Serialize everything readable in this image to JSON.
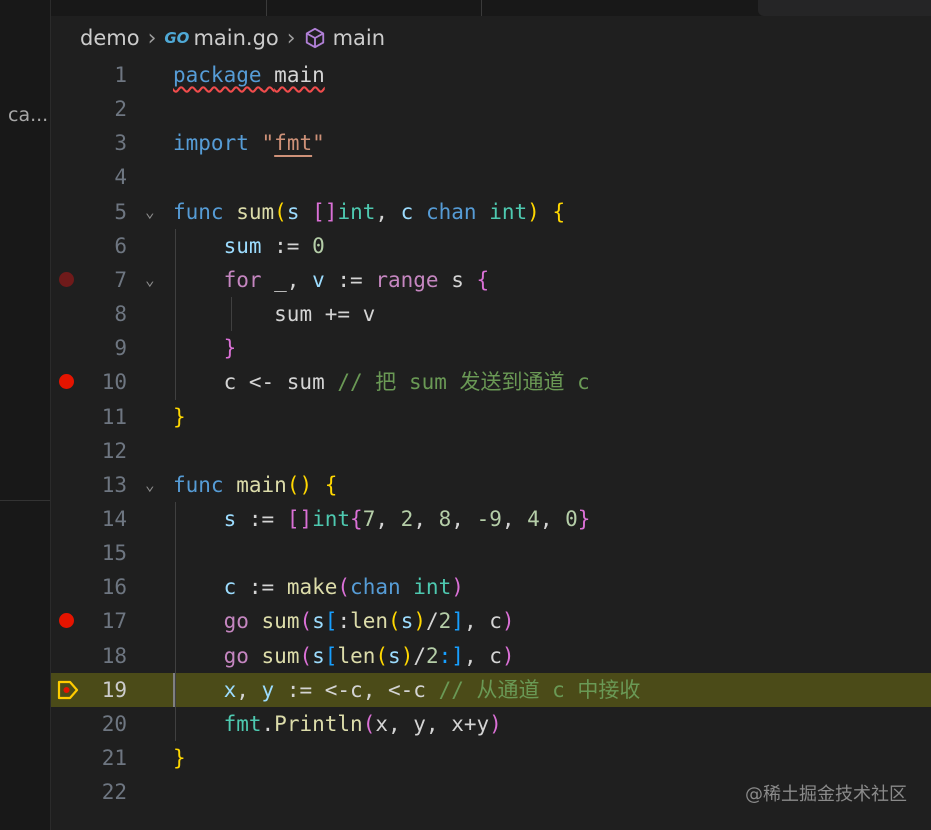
{
  "sidebar": {
    "label": "ca..."
  },
  "breadcrumb": {
    "folder": "demo",
    "file_icon_text": "GO",
    "file": "main.go",
    "symbol": "main"
  },
  "lines": [
    {
      "n": "1",
      "tokens": [
        [
          "package",
          "kw squig"
        ],
        [
          " ",
          "squig"
        ],
        [
          "main",
          "squig"
        ]
      ]
    },
    {
      "n": "2",
      "tokens": []
    },
    {
      "n": "3",
      "tokens": [
        [
          "import",
          "kw"
        ],
        [
          " ",
          ""
        ],
        [
          "\"",
          "str"
        ],
        [
          "fmt",
          "str str-u"
        ],
        [
          "\"",
          "str"
        ]
      ]
    },
    {
      "n": "4",
      "tokens": []
    },
    {
      "n": "5",
      "fold": true,
      "tokens": [
        [
          "func",
          "kw"
        ],
        [
          " ",
          ""
        ],
        [
          "sum",
          "fn"
        ],
        [
          "(",
          "b1"
        ],
        [
          "s",
          "var"
        ],
        [
          " ",
          ""
        ],
        [
          "[]",
          "b2"
        ],
        [
          "int",
          "type"
        ],
        [
          ", ",
          ""
        ],
        [
          "c",
          "var"
        ],
        [
          " ",
          ""
        ],
        [
          "chan",
          "kw"
        ],
        [
          " ",
          ""
        ],
        [
          "int",
          "type"
        ],
        [
          ")",
          "b1"
        ],
        [
          " ",
          ""
        ],
        [
          "{",
          "b1"
        ]
      ]
    },
    {
      "n": "6",
      "tokens": [
        [
          "    ",
          ""
        ],
        [
          "sum",
          "var"
        ],
        [
          " := ",
          ""
        ],
        [
          "0",
          "num"
        ]
      ]
    },
    {
      "n": "7",
      "bp": "dim",
      "fold": true,
      "tokens": [
        [
          "    ",
          ""
        ],
        [
          "for",
          "ctl"
        ],
        [
          " _, ",
          ""
        ],
        [
          "v",
          "var"
        ],
        [
          " := ",
          ""
        ],
        [
          "range",
          "ctl"
        ],
        [
          " s ",
          ""
        ],
        [
          "{",
          "b2"
        ]
      ]
    },
    {
      "n": "8",
      "tokens": [
        [
          "        ",
          ""
        ],
        [
          "sum += v",
          ""
        ]
      ]
    },
    {
      "n": "9",
      "tokens": [
        [
          "    ",
          ""
        ],
        [
          "}",
          "b2"
        ]
      ]
    },
    {
      "n": "10",
      "bp": "on",
      "tokens": [
        [
          "    ",
          ""
        ],
        [
          "c <- sum ",
          ""
        ],
        [
          "// 把 sum 发送到通道 c",
          "cmt"
        ]
      ]
    },
    {
      "n": "11",
      "tokens": [
        [
          "}",
          "b1"
        ]
      ]
    },
    {
      "n": "12",
      "tokens": []
    },
    {
      "n": "13",
      "fold": true,
      "tokens": [
        [
          "func",
          "kw"
        ],
        [
          " ",
          ""
        ],
        [
          "main",
          "fn"
        ],
        [
          "()",
          "b1"
        ],
        [
          " ",
          ""
        ],
        [
          "{",
          "b1"
        ]
      ]
    },
    {
      "n": "14",
      "tokens": [
        [
          "    ",
          ""
        ],
        [
          "s",
          "var"
        ],
        [
          " := ",
          ""
        ],
        [
          "[]",
          "b2"
        ],
        [
          "int",
          "type"
        ],
        [
          "{",
          "b2"
        ],
        [
          "7",
          "num"
        ],
        [
          ", ",
          ""
        ],
        [
          "2",
          "num"
        ],
        [
          ", ",
          ""
        ],
        [
          "8",
          "num"
        ],
        [
          ", ",
          ""
        ],
        [
          "-9",
          "num"
        ],
        [
          ", ",
          ""
        ],
        [
          "4",
          "num"
        ],
        [
          ", ",
          ""
        ],
        [
          "0",
          "num"
        ],
        [
          "}",
          "b2"
        ]
      ]
    },
    {
      "n": "15",
      "tokens": []
    },
    {
      "n": "16",
      "tokens": [
        [
          "    ",
          ""
        ],
        [
          "c",
          "var"
        ],
        [
          " := ",
          ""
        ],
        [
          "make",
          "fn"
        ],
        [
          "(",
          "b2"
        ],
        [
          "chan",
          "kw"
        ],
        [
          " ",
          ""
        ],
        [
          "int",
          "type"
        ],
        [
          ")",
          "b2"
        ]
      ]
    },
    {
      "n": "17",
      "bp": "on",
      "tokens": [
        [
          "    ",
          ""
        ],
        [
          "go",
          "ctl"
        ],
        [
          " ",
          ""
        ],
        [
          "sum",
          "fn"
        ],
        [
          "(",
          "b2"
        ],
        [
          "s",
          "var"
        ],
        [
          "[",
          "b3"
        ],
        [
          ":",
          ""
        ],
        [
          "len",
          "fn"
        ],
        [
          "(",
          "b1"
        ],
        [
          "s",
          "var"
        ],
        [
          ")",
          "b1"
        ],
        [
          "/",
          ""
        ],
        [
          "2",
          "num"
        ],
        [
          "]",
          "b3"
        ],
        [
          ", c",
          ""
        ],
        [
          ")",
          "b2"
        ]
      ]
    },
    {
      "n": "18",
      "tokens": [
        [
          "    ",
          ""
        ],
        [
          "go",
          "ctl"
        ],
        [
          " ",
          ""
        ],
        [
          "sum",
          "fn"
        ],
        [
          "(",
          "b2"
        ],
        [
          "s",
          "var"
        ],
        [
          "[",
          "b3"
        ],
        [
          "len",
          "fn"
        ],
        [
          "(",
          "b1"
        ],
        [
          "s",
          "var"
        ],
        [
          ")",
          "b1"
        ],
        [
          "/",
          ""
        ],
        [
          "2",
          "num"
        ],
        [
          ":]",
          "b3"
        ],
        [
          ", c",
          ""
        ],
        [
          ")",
          "b2"
        ]
      ]
    },
    {
      "n": "19",
      "current": true,
      "tokens": [
        [
          "    ",
          ""
        ],
        [
          "x",
          "var"
        ],
        [
          ", ",
          ""
        ],
        [
          "y",
          "var"
        ],
        [
          " := <-c, <-c ",
          ""
        ],
        [
          "// 从通道 c 中接收",
          "cmt"
        ]
      ]
    },
    {
      "n": "20",
      "tokens": [
        [
          "    ",
          ""
        ],
        [
          "fmt",
          "type"
        ],
        [
          ".",
          ""
        ],
        [
          "Println",
          "fn"
        ],
        [
          "(",
          "b2"
        ],
        [
          "x, y, x+y",
          ""
        ],
        [
          ")",
          "b2"
        ]
      ]
    },
    {
      "n": "21",
      "tokens": [
        [
          "}",
          "b1"
        ]
      ]
    },
    {
      "n": "22",
      "tokens": []
    }
  ],
  "watermark": "@稀土掘金技术社区",
  "colors": {
    "breakpoint": "#e51400",
    "current_line": "#4b4b18",
    "debug_arrow": "#ffcc00"
  }
}
